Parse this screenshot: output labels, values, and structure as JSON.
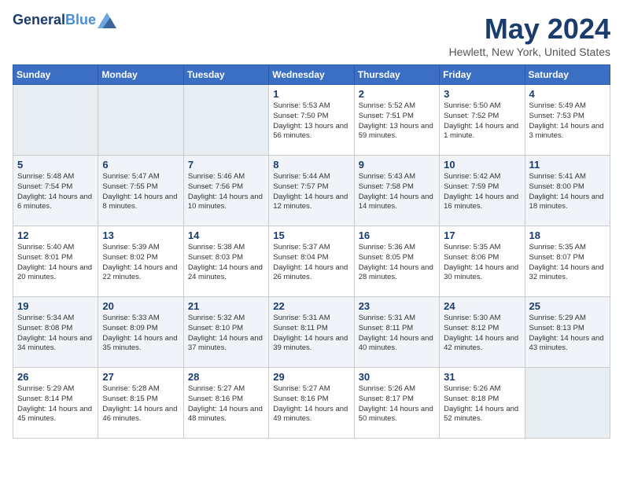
{
  "header": {
    "logo_line1": "General",
    "logo_line2": "Blue",
    "title": "May 2024",
    "subtitle": "Hewlett, New York, United States"
  },
  "weekdays": [
    "Sunday",
    "Monday",
    "Tuesday",
    "Wednesday",
    "Thursday",
    "Friday",
    "Saturday"
  ],
  "weeks": [
    [
      {
        "day": "",
        "info": ""
      },
      {
        "day": "",
        "info": ""
      },
      {
        "day": "",
        "info": ""
      },
      {
        "day": "1",
        "info": "Sunrise: 5:53 AM\nSunset: 7:50 PM\nDaylight: 13 hours and 56 minutes."
      },
      {
        "day": "2",
        "info": "Sunrise: 5:52 AM\nSunset: 7:51 PM\nDaylight: 13 hours and 59 minutes."
      },
      {
        "day": "3",
        "info": "Sunrise: 5:50 AM\nSunset: 7:52 PM\nDaylight: 14 hours and 1 minute."
      },
      {
        "day": "4",
        "info": "Sunrise: 5:49 AM\nSunset: 7:53 PM\nDaylight: 14 hours and 3 minutes."
      }
    ],
    [
      {
        "day": "5",
        "info": "Sunrise: 5:48 AM\nSunset: 7:54 PM\nDaylight: 14 hours and 6 minutes."
      },
      {
        "day": "6",
        "info": "Sunrise: 5:47 AM\nSunset: 7:55 PM\nDaylight: 14 hours and 8 minutes."
      },
      {
        "day": "7",
        "info": "Sunrise: 5:46 AM\nSunset: 7:56 PM\nDaylight: 14 hours and 10 minutes."
      },
      {
        "day": "8",
        "info": "Sunrise: 5:44 AM\nSunset: 7:57 PM\nDaylight: 14 hours and 12 minutes."
      },
      {
        "day": "9",
        "info": "Sunrise: 5:43 AM\nSunset: 7:58 PM\nDaylight: 14 hours and 14 minutes."
      },
      {
        "day": "10",
        "info": "Sunrise: 5:42 AM\nSunset: 7:59 PM\nDaylight: 14 hours and 16 minutes."
      },
      {
        "day": "11",
        "info": "Sunrise: 5:41 AM\nSunset: 8:00 PM\nDaylight: 14 hours and 18 minutes."
      }
    ],
    [
      {
        "day": "12",
        "info": "Sunrise: 5:40 AM\nSunset: 8:01 PM\nDaylight: 14 hours and 20 minutes."
      },
      {
        "day": "13",
        "info": "Sunrise: 5:39 AM\nSunset: 8:02 PM\nDaylight: 14 hours and 22 minutes."
      },
      {
        "day": "14",
        "info": "Sunrise: 5:38 AM\nSunset: 8:03 PM\nDaylight: 14 hours and 24 minutes."
      },
      {
        "day": "15",
        "info": "Sunrise: 5:37 AM\nSunset: 8:04 PM\nDaylight: 14 hours and 26 minutes."
      },
      {
        "day": "16",
        "info": "Sunrise: 5:36 AM\nSunset: 8:05 PM\nDaylight: 14 hours and 28 minutes."
      },
      {
        "day": "17",
        "info": "Sunrise: 5:35 AM\nSunset: 8:06 PM\nDaylight: 14 hours and 30 minutes."
      },
      {
        "day": "18",
        "info": "Sunrise: 5:35 AM\nSunset: 8:07 PM\nDaylight: 14 hours and 32 minutes."
      }
    ],
    [
      {
        "day": "19",
        "info": "Sunrise: 5:34 AM\nSunset: 8:08 PM\nDaylight: 14 hours and 34 minutes."
      },
      {
        "day": "20",
        "info": "Sunrise: 5:33 AM\nSunset: 8:09 PM\nDaylight: 14 hours and 35 minutes."
      },
      {
        "day": "21",
        "info": "Sunrise: 5:32 AM\nSunset: 8:10 PM\nDaylight: 14 hours and 37 minutes."
      },
      {
        "day": "22",
        "info": "Sunrise: 5:31 AM\nSunset: 8:11 PM\nDaylight: 14 hours and 39 minutes."
      },
      {
        "day": "23",
        "info": "Sunrise: 5:31 AM\nSunset: 8:11 PM\nDaylight: 14 hours and 40 minutes."
      },
      {
        "day": "24",
        "info": "Sunrise: 5:30 AM\nSunset: 8:12 PM\nDaylight: 14 hours and 42 minutes."
      },
      {
        "day": "25",
        "info": "Sunrise: 5:29 AM\nSunset: 8:13 PM\nDaylight: 14 hours and 43 minutes."
      }
    ],
    [
      {
        "day": "26",
        "info": "Sunrise: 5:29 AM\nSunset: 8:14 PM\nDaylight: 14 hours and 45 minutes."
      },
      {
        "day": "27",
        "info": "Sunrise: 5:28 AM\nSunset: 8:15 PM\nDaylight: 14 hours and 46 minutes."
      },
      {
        "day": "28",
        "info": "Sunrise: 5:27 AM\nSunset: 8:16 PM\nDaylight: 14 hours and 48 minutes."
      },
      {
        "day": "29",
        "info": "Sunrise: 5:27 AM\nSunset: 8:16 PM\nDaylight: 14 hours and 49 minutes."
      },
      {
        "day": "30",
        "info": "Sunrise: 5:26 AM\nSunset: 8:17 PM\nDaylight: 14 hours and 50 minutes."
      },
      {
        "day": "31",
        "info": "Sunrise: 5:26 AM\nSunset: 8:18 PM\nDaylight: 14 hours and 52 minutes."
      },
      {
        "day": "",
        "info": ""
      }
    ]
  ]
}
